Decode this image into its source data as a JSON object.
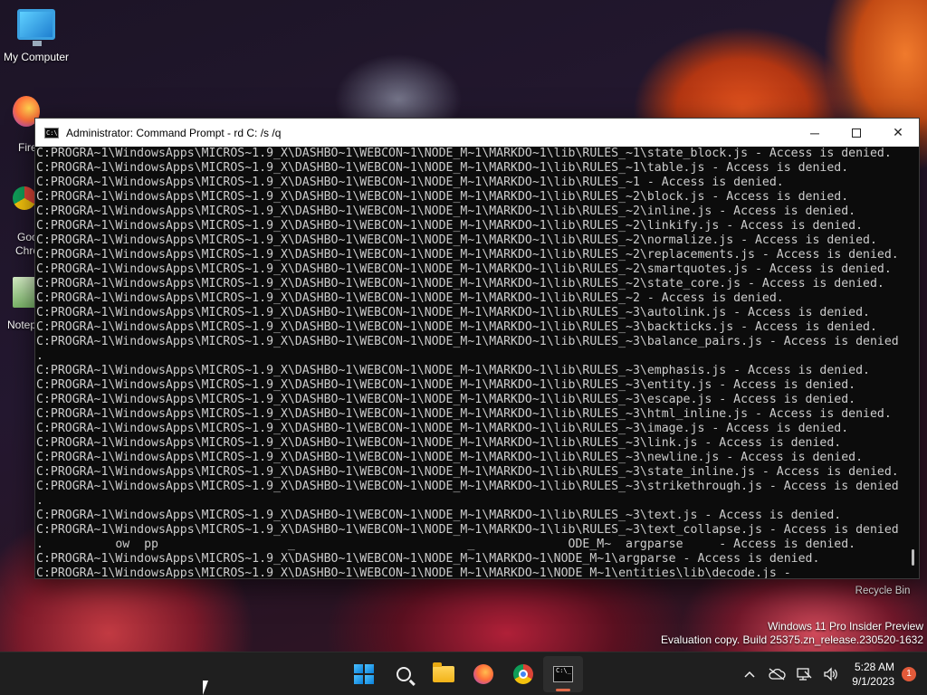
{
  "desktop": {
    "icons": [
      {
        "label": "My Computer",
        "icon": "monitor-icon"
      },
      {
        "label": "Fire",
        "icon": "firefox-icon"
      },
      {
        "label": "Goo",
        "icon": "chrome-icon"
      },
      {
        "label": "Chro",
        "icon": "chrome-icon"
      },
      {
        "label": "Notep",
        "icon": "notepad-icon"
      }
    ],
    "recycle_bin_label": "Recycle Bin",
    "watermark": {
      "line1": "Windows 11 Pro Insider Preview",
      "line2": "Evaluation copy. Build 25375.zn_release.230520-1632"
    }
  },
  "window": {
    "title": "Administrator:  Command Prompt - rd  C: /s /q",
    "minimize_label": "─",
    "close_label": "✕",
    "console_lines": [
      "C:PROGRA~1\\WindowsApps\\MICROS~1.9_X\\DASHBO~1\\WEBCON~1\\NODE_M~1\\MARKDO~1\\lib\\RULES_~1\\state_block.js - Access is denied.",
      "C:PROGRA~1\\WindowsApps\\MICROS~1.9_X\\DASHBO~1\\WEBCON~1\\NODE_M~1\\MARKDO~1\\lib\\RULES_~1\\table.js - Access is denied.",
      "C:PROGRA~1\\WindowsApps\\MICROS~1.9_X\\DASHBO~1\\WEBCON~1\\NODE_M~1\\MARKDO~1\\lib\\RULES_~1 - Access is denied.",
      "C:PROGRA~1\\WindowsApps\\MICROS~1.9_X\\DASHBO~1\\WEBCON~1\\NODE_M~1\\MARKDO~1\\lib\\RULES_~2\\block.js - Access is denied.",
      "C:PROGRA~1\\WindowsApps\\MICROS~1.9_X\\DASHBO~1\\WEBCON~1\\NODE_M~1\\MARKDO~1\\lib\\RULES_~2\\inline.js - Access is denied.",
      "C:PROGRA~1\\WindowsApps\\MICROS~1.9_X\\DASHBO~1\\WEBCON~1\\NODE_M~1\\MARKDO~1\\lib\\RULES_~2\\linkify.js - Access is denied.",
      "C:PROGRA~1\\WindowsApps\\MICROS~1.9_X\\DASHBO~1\\WEBCON~1\\NODE_M~1\\MARKDO~1\\lib\\RULES_~2\\normalize.js - Access is denied.",
      "C:PROGRA~1\\WindowsApps\\MICROS~1.9_X\\DASHBO~1\\WEBCON~1\\NODE_M~1\\MARKDO~1\\lib\\RULES_~2\\replacements.js - Access is denied.",
      "C:PROGRA~1\\WindowsApps\\MICROS~1.9_X\\DASHBO~1\\WEBCON~1\\NODE_M~1\\MARKDO~1\\lib\\RULES_~2\\smartquotes.js - Access is denied.",
      "C:PROGRA~1\\WindowsApps\\MICROS~1.9_X\\DASHBO~1\\WEBCON~1\\NODE_M~1\\MARKDO~1\\lib\\RULES_~2\\state_core.js - Access is denied.",
      "C:PROGRA~1\\WindowsApps\\MICROS~1.9_X\\DASHBO~1\\WEBCON~1\\NODE_M~1\\MARKDO~1\\lib\\RULES_~2 - Access is denied.",
      "C:PROGRA~1\\WindowsApps\\MICROS~1.9_X\\DASHBO~1\\WEBCON~1\\NODE_M~1\\MARKDO~1\\lib\\RULES_~3\\autolink.js - Access is denied.",
      "C:PROGRA~1\\WindowsApps\\MICROS~1.9_X\\DASHBO~1\\WEBCON~1\\NODE_M~1\\MARKDO~1\\lib\\RULES_~3\\backticks.js - Access is denied.",
      "C:PROGRA~1\\WindowsApps\\MICROS~1.9_X\\DASHBO~1\\WEBCON~1\\NODE_M~1\\MARKDO~1\\lib\\RULES_~3\\balance_pairs.js - Access is denied",
      ".",
      "C:PROGRA~1\\WindowsApps\\MICROS~1.9_X\\DASHBO~1\\WEBCON~1\\NODE_M~1\\MARKDO~1\\lib\\RULES_~3\\emphasis.js - Access is denied.",
      "C:PROGRA~1\\WindowsApps\\MICROS~1.9_X\\DASHBO~1\\WEBCON~1\\NODE_M~1\\MARKDO~1\\lib\\RULES_~3\\entity.js - Access is denied.",
      "C:PROGRA~1\\WindowsApps\\MICROS~1.9_X\\DASHBO~1\\WEBCON~1\\NODE_M~1\\MARKDO~1\\lib\\RULES_~3\\escape.js - Access is denied.",
      "C:PROGRA~1\\WindowsApps\\MICROS~1.9_X\\DASHBO~1\\WEBCON~1\\NODE_M~1\\MARKDO~1\\lib\\RULES_~3\\html_inline.js - Access is denied.",
      "C:PROGRA~1\\WindowsApps\\MICROS~1.9_X\\DASHBO~1\\WEBCON~1\\NODE_M~1\\MARKDO~1\\lib\\RULES_~3\\image.js - Access is denied.",
      "C:PROGRA~1\\WindowsApps\\MICROS~1.9_X\\DASHBO~1\\WEBCON~1\\NODE_M~1\\MARKDO~1\\lib\\RULES_~3\\link.js - Access is denied.",
      "C:PROGRA~1\\WindowsApps\\MICROS~1.9_X\\DASHBO~1\\WEBCON~1\\NODE_M~1\\MARKDO~1\\lib\\RULES_~3\\newline.js - Access is denied.",
      "C:PROGRA~1\\WindowsApps\\MICROS~1.9_X\\DASHBO~1\\WEBCON~1\\NODE_M~1\\MARKDO~1\\lib\\RULES_~3\\state_inline.js - Access is denied.",
      "C:PROGRA~1\\WindowsApps\\MICROS~1.9_X\\DASHBO~1\\WEBCON~1\\NODE_M~1\\MARKDO~1\\lib\\RULES_~3\\strikethrough.js - Access is denied",
      ".",
      "C:PROGRA~1\\WindowsApps\\MICROS~1.9_X\\DASHBO~1\\WEBCON~1\\NODE_M~1\\MARKDO~1\\lib\\RULES_~3\\text.js - Access is denied.",
      "C:PROGRA~1\\WindowsApps\\MICROS~1.9_X\\DASHBO~1\\WEBCON~1\\NODE_M~1\\MARKDO~1\\lib\\RULES_~3\\text_collapse.js - Access is denied",
      ".          ow  pp                  _                        _             ODE_M~  argparse     - Access is denied.",
      "C:PROGRA~1\\WindowsApps\\MICROS~1.9_X\\DASHBO~1\\WEBCON~1\\NODE_M~1\\MARKDO~1\\NODE_M~1\\argparse - Access is denied.",
      "C:PROGRA~1\\WindowsApps\\MICROS~1.9_X\\DASHBO~1\\WEBCON~1\\NODE_M~1\\MARKDO~1\\NODE_M~1\\entities\\lib\\decode.js - _"
    ]
  },
  "taskbar": {
    "apps": [
      {
        "name": "start",
        "icon": "windows-logo-icon"
      },
      {
        "name": "search",
        "icon": "search-icon"
      },
      {
        "name": "file-explorer",
        "icon": "folder-icon"
      },
      {
        "name": "firefox",
        "icon": "firefox-icon"
      },
      {
        "name": "chrome",
        "icon": "chrome-icon"
      },
      {
        "name": "command-prompt",
        "icon": "terminal-icon",
        "active": true
      }
    ],
    "clock": {
      "time": "5:28 AM",
      "date": "9/1/2023"
    },
    "notification_count": "1"
  },
  "colors": {
    "console_bg": "#0c0c0c",
    "console_text": "#cccccc",
    "taskbar_bg": "#1f1f1f",
    "active_indicator": "#e06a4a",
    "notification_badge": "#e25a3a"
  }
}
